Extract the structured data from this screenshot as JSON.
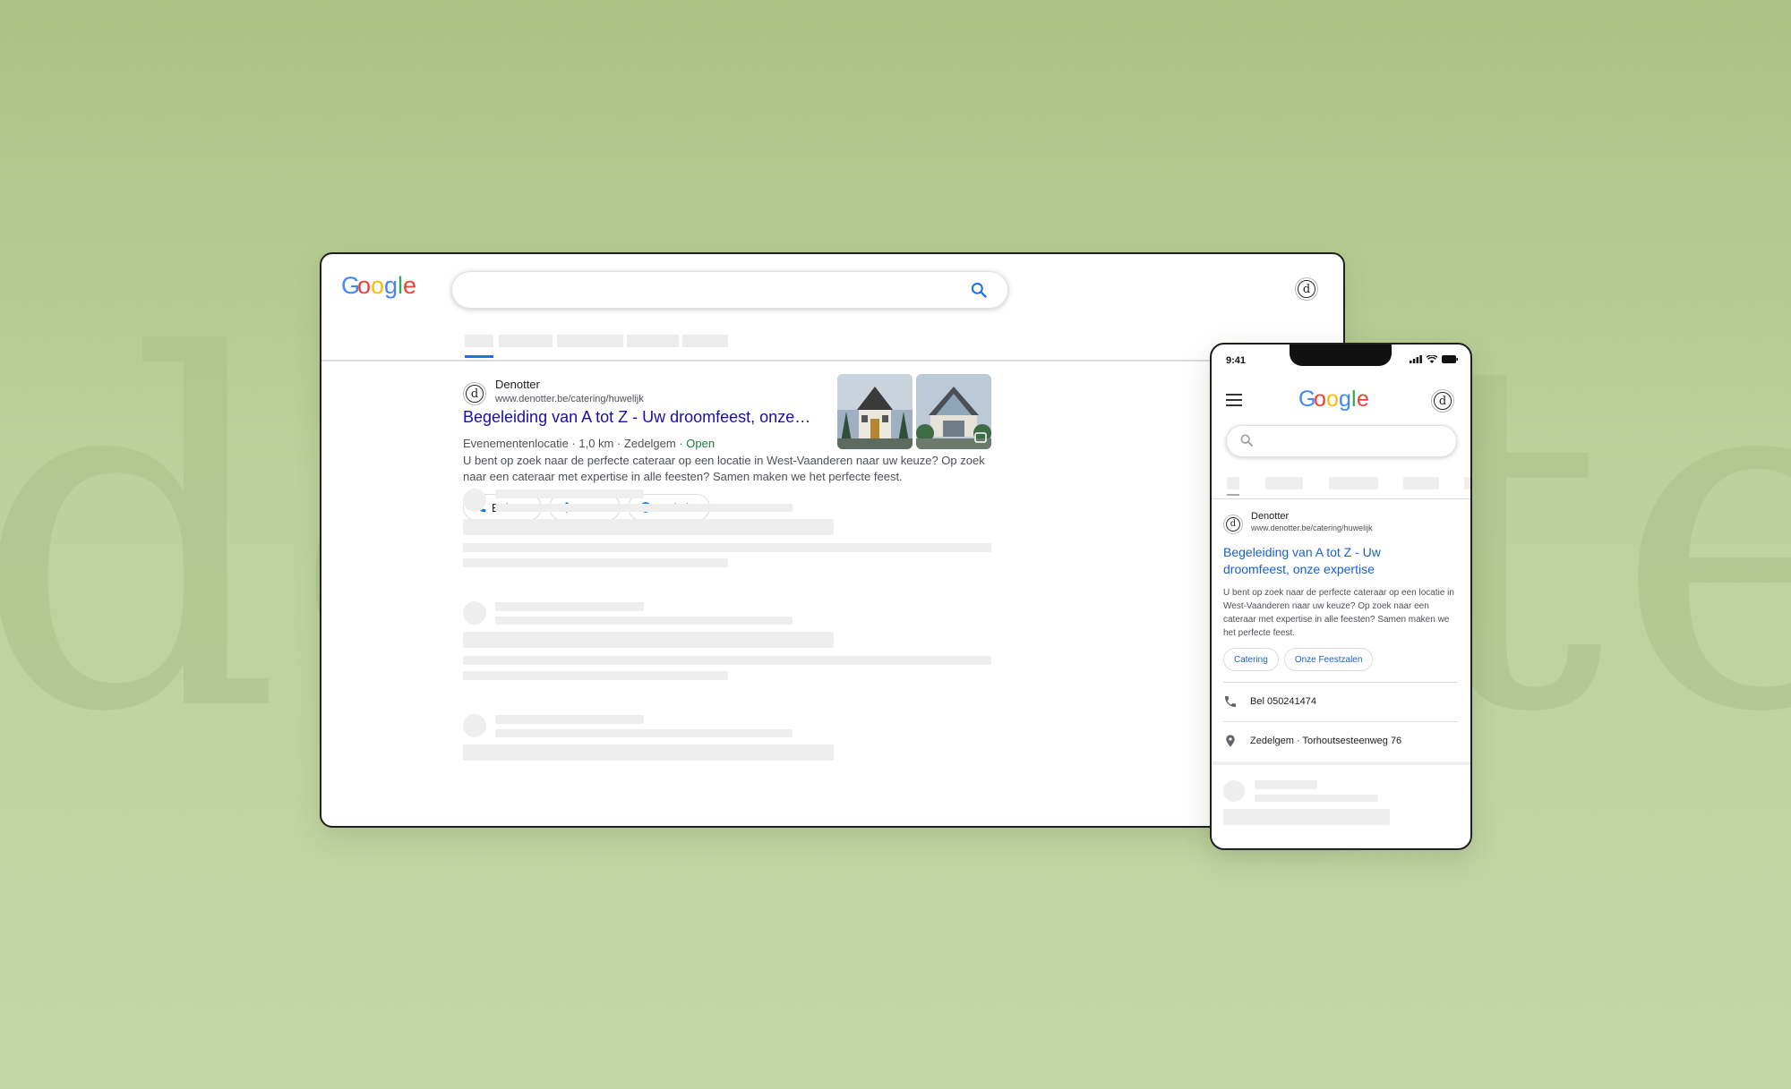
{
  "background": {
    "watermark_text": "denotter",
    "color": "#bdd19c"
  },
  "brand": {
    "google_logo": [
      "G",
      "o",
      "o",
      "g",
      "l",
      "e"
    ],
    "google_colors": [
      "#4285F4",
      "#EA4335",
      "#FBBC05",
      "#4285F4",
      "#34A853",
      "#EA4335"
    ],
    "avatar_letter": "d"
  },
  "desktop": {
    "search": {
      "value": "",
      "icon": "search-icon"
    },
    "result": {
      "site_name": "Denotter",
      "site_url": "www.denotter.be/catering/huwelijk",
      "title": "Begeleiding van A tot Z - Uw droomfeest, onze…",
      "meta_prefix": "Evenementenlocatie · 1,0 km · Zedelgem · ",
      "meta_status": "Open",
      "snippet": "U bent op zoek naar de perfecte cateraar op een locatie in West-Vaanderen naar uw keuze? Op zoek naar een cateraar met expertise in alle feesten? Samen maken we het perfecte feest.",
      "actions": [
        {
          "label": "Bel ons",
          "icon": "phone-icon"
        },
        {
          "label": "Route",
          "icon": "directions-icon"
        },
        {
          "label": "Website",
          "icon": "globe-icon"
        }
      ]
    }
  },
  "phone": {
    "time": "9:41",
    "result": {
      "site_name": "Denotter",
      "site_url": "www.denotter.be/catering/huwelijk",
      "title": "Begeleiding van A tot Z - Uw droomfeest, onze expertise",
      "snippet": "U bent op zoek naar de perfecte cateraar op een locatie in West-Vaanderen naar uw keuze? Op zoek naar een cateraar met expertise in alle feesten? Samen maken we het perfecte feest.",
      "chips": [
        "Catering",
        "Onze Feestzalen"
      ],
      "phone_label": "Bel 050241474",
      "address": "Zedelgem · Torhoutsesteenweg 76"
    }
  }
}
